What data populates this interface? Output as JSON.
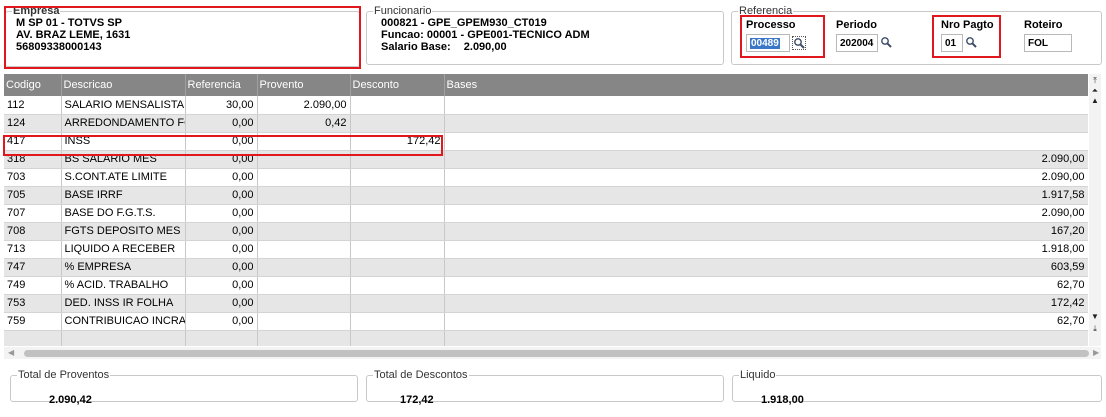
{
  "empresa": {
    "legend": "Empresa",
    "line1": "M SP 01  - TOTVS SP",
    "line2": "AV. BRAZ LEME, 1631",
    "line3": "56809338000143"
  },
  "funcionario": {
    "legend": "Funcionario",
    "line1": "000821 - GPE_GPEM930_CT019",
    "line2": "Funcao: 00001 - GPE001-TECNICO ADM",
    "salario_label": "Salario Base:",
    "salario_value": "2.090,00"
  },
  "referencia": {
    "legend": "Referencia",
    "processo_label": "Processo",
    "processo_value": "00489",
    "periodo_label": "Periodo",
    "periodo_value": "202004",
    "nropagto_label": "Nro Pagto",
    "nropagto_value": "01",
    "roteiro_label": "Roteiro",
    "roteiro_value": "FOL"
  },
  "grid": {
    "columns": [
      "Codigo",
      "Descricao",
      "Referencia",
      "Provento",
      "Desconto",
      "Bases"
    ],
    "rows": [
      {
        "codigo": "112",
        "descricao": "SALARIO MENSALISTA",
        "referencia": "30,00",
        "provento": "2.090,00",
        "desconto": "",
        "bases": ""
      },
      {
        "codigo": "124",
        "descricao": "ARREDONDAMENTO FOLHA",
        "referencia": "0,00",
        "provento": "0,42",
        "desconto": "",
        "bases": ""
      },
      {
        "codigo": "417",
        "descricao": "INSS",
        "referencia": "0,00",
        "provento": "",
        "desconto": "172,42",
        "bases": ""
      },
      {
        "codigo": "318",
        "descricao": "BS SALARIO MES",
        "referencia": "0,00",
        "provento": "",
        "desconto": "",
        "bases": "2.090,00"
      },
      {
        "codigo": "703",
        "descricao": "S.CONT.ATE LIMITE",
        "referencia": "0,00",
        "provento": "",
        "desconto": "",
        "bases": "2.090,00"
      },
      {
        "codigo": "705",
        "descricao": "BASE IRRF",
        "referencia": "0,00",
        "provento": "",
        "desconto": "",
        "bases": "1.917,58"
      },
      {
        "codigo": "707",
        "descricao": "BASE DO F.G.T.S.",
        "referencia": "0,00",
        "provento": "",
        "desconto": "",
        "bases": "2.090,00"
      },
      {
        "codigo": "708",
        "descricao": "FGTS DEPOSITO MES",
        "referencia": "0,00",
        "provento": "",
        "desconto": "",
        "bases": "167,20"
      },
      {
        "codigo": "713",
        "descricao": "LIQUIDO A RECEBER",
        "referencia": "0,00",
        "provento": "",
        "desconto": "",
        "bases": "1.918,00"
      },
      {
        "codigo": "747",
        "descricao": "% EMPRESA",
        "referencia": "0,00",
        "provento": "",
        "desconto": "",
        "bases": "603,59"
      },
      {
        "codigo": "749",
        "descricao": "% ACID. TRABALHO",
        "referencia": "0,00",
        "provento": "",
        "desconto": "",
        "bases": "62,70"
      },
      {
        "codigo": "753",
        "descricao": "DED. INSS IR FOLHA",
        "referencia": "0,00",
        "provento": "",
        "desconto": "",
        "bases": "172,42"
      },
      {
        "codigo": "759",
        "descricao": "CONTRIBUICAO INCRA",
        "referencia": "0,00",
        "provento": "",
        "desconto": "",
        "bases": "62,70"
      },
      {
        "codigo": "",
        "descricao": "",
        "referencia": "",
        "provento": "",
        "desconto": "",
        "bases": ""
      }
    ]
  },
  "totais": {
    "proventos_label": "Total de Proventos",
    "proventos_value": "2.090,42",
    "descontos_label": "Total de Descontos",
    "descontos_value": "172,42",
    "liquido_label": "Liquido",
    "liquido_value": "1.918,00"
  },
  "colors": {
    "highlight": "#e0171c",
    "header_bg": "#868686",
    "selection": "#3a77c8"
  },
  "icons": {
    "lookup": "magnifier-icon",
    "scroll": [
      "scroll-top-icon",
      "scroll-page-up-icon",
      "scroll-up-icon",
      "scroll-down-icon",
      "scroll-bottom-icon",
      "scroll-left-icon",
      "scroll-right-icon"
    ]
  }
}
